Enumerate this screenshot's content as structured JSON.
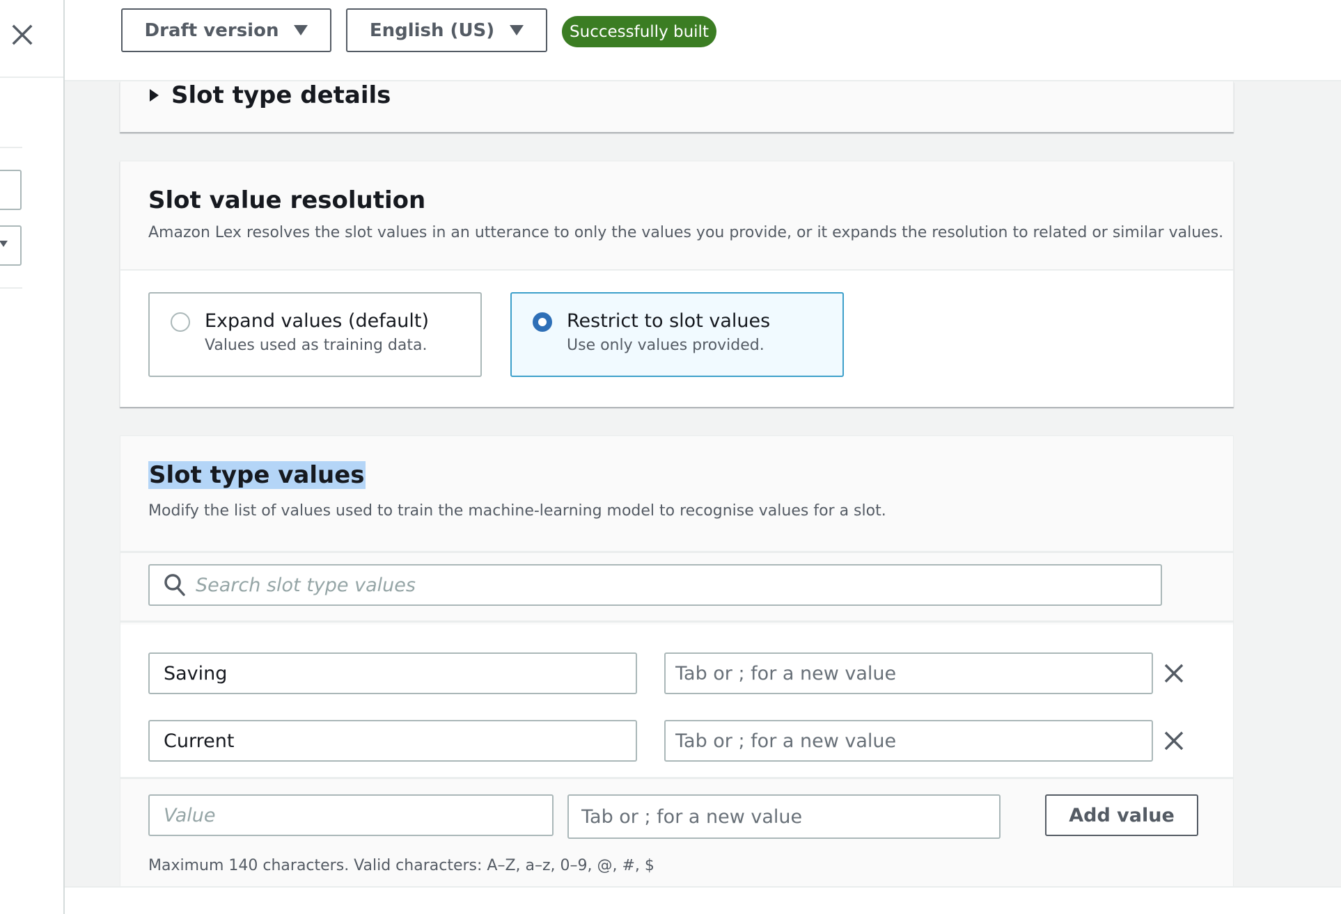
{
  "sidebar": {
    "close_icon": "close-icon"
  },
  "header": {
    "version_select": {
      "label": "Draft version",
      "icon": "caret-down-icon"
    },
    "language_select": {
      "label": "English (US)",
      "icon": "caret-down-icon"
    },
    "build_status": {
      "label": "Successfully built",
      "color": "#3b7d23"
    }
  },
  "slot_type_details": {
    "title": "Slot type details",
    "expanded": false
  },
  "slot_value_resolution": {
    "title": "Slot value resolution",
    "description": "Amazon Lex resolves the slot values in an utterance to only the values you provide, or it expands the resolution to related or similar values.",
    "options": [
      {
        "label": "Expand values (default)",
        "description": "Values used as training data.",
        "selected": false
      },
      {
        "label": "Restrict to slot values",
        "description": "Use only values provided.",
        "selected": true
      }
    ],
    "accent_color": "#2e6fb7"
  },
  "slot_type_values": {
    "title": "Slot type values",
    "description": "Modify the list of values used to train the machine-learning model to recognise values for a slot.",
    "search": {
      "placeholder": "Search slot type values",
      "value": ""
    },
    "rows": [
      {
        "value": "Saving",
        "synonyms_placeholder": "Tab or ; for a new value"
      },
      {
        "value": "Current",
        "synonyms_placeholder": "Tab or ; for a new value"
      }
    ],
    "new_value": {
      "value_placeholder": "Value",
      "synonyms_placeholder": "Tab or ; for a new value",
      "add_button_label": "Add value",
      "constraint": "Maximum 140 characters. Valid characters: A–Z, a–z, 0–9, @, #, $"
    }
  }
}
